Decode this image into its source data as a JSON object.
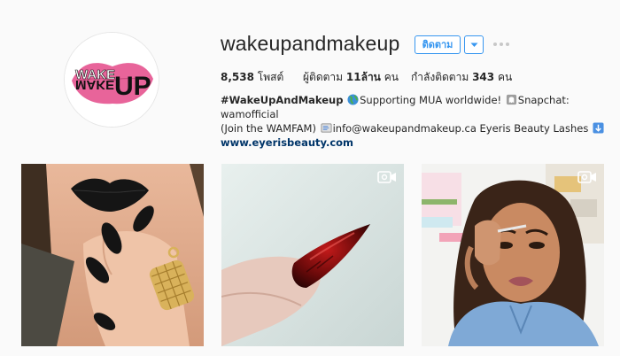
{
  "profile": {
    "username": "wakeupandmakeup",
    "avatar_alt": "WAKE UP MAKE UP logo",
    "follow_label": "ติดตาม",
    "posts_count": "8,538",
    "posts_label": "โพสต์",
    "followers_label": "ผู้ติดตาม",
    "followers_count": "11ล้าน",
    "followers_unit": "คน",
    "following_label": "กำลังติดตาม",
    "following_count": "343",
    "following_unit": "คน"
  },
  "bio": {
    "name": "#WakeUpAndMakeup",
    "line1_text": "Supporting MUA worldwide!",
    "snapchat": "Snapchat: wamofficial",
    "line2_text": "(Join the WAMFAM)",
    "email": "info@wakeupandmakeup.ca Eyeris Beauty Lashes",
    "link": "www.eyerisbeauty.com"
  },
  "logo": {
    "line1": "WAKE",
    "line2": "MAKE",
    "up": "UP"
  },
  "posts": [
    {
      "kind": "photo",
      "desc": "black matte lips and nails"
    },
    {
      "kind": "video",
      "desc": "red stiletto nail"
    },
    {
      "kind": "video",
      "desc": "woman applying eyeliner"
    }
  ],
  "colors": {
    "accent": "#3897f0",
    "link": "#003569",
    "logo_pink": "#e8649a"
  }
}
